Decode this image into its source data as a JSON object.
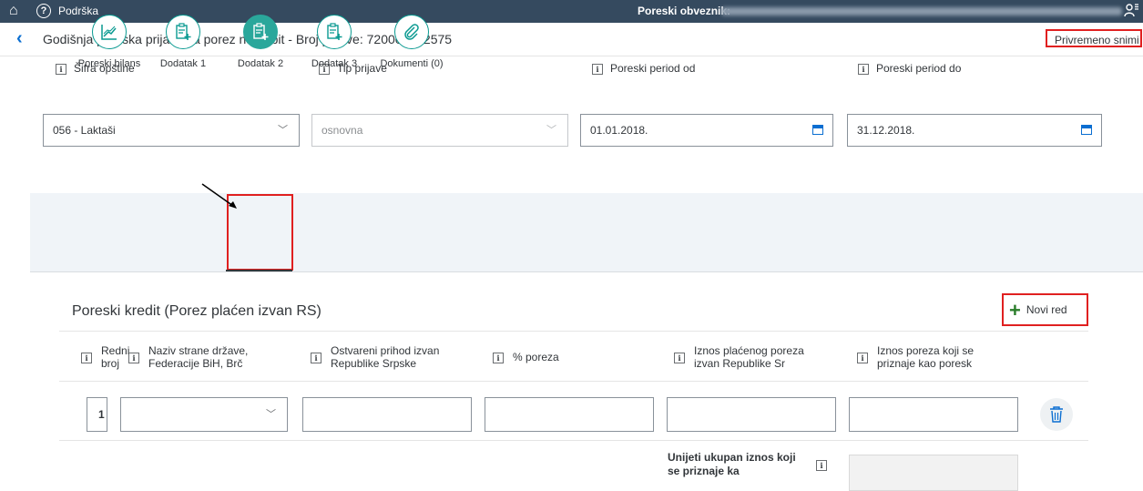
{
  "topbar": {
    "help_label": "Podrška",
    "taxpayer_label": "Poreski obveznik:"
  },
  "header": {
    "title": "Godišnja poreska prijava za porez na dobit - Broj prijave: 720000002575",
    "save_label": "Privremeno snimi"
  },
  "fields": {
    "opstina": {
      "label": "Šifra opštine",
      "value": "056 - Laktaši"
    },
    "tip": {
      "label": "Tip prijave",
      "value": "osnovna"
    },
    "period_od": {
      "label": "Poreski period od",
      "value": "01.01.2018."
    },
    "period_do": {
      "label": "Poreski period do",
      "value": "31.12.2018."
    }
  },
  "tabs": [
    {
      "label": "Poreski bilans",
      "icon": "chart-icon"
    },
    {
      "label": "Dodatak 1",
      "icon": "clipboard-add-icon"
    },
    {
      "label": "Dodatak 2",
      "icon": "clipboard-add-icon",
      "selected": true
    },
    {
      "label": "Dodatak 3",
      "icon": "clipboard-add-icon"
    },
    {
      "label": "Dokumenti (0)",
      "icon": "paperclip-icon"
    }
  ],
  "section": {
    "title": "Poreski kredit (Porez plaćen izvan RS)",
    "new_row_label": "Novi red"
  },
  "table": {
    "headers": [
      [
        "Redni",
        "broj"
      ],
      [
        "Naziv strane države,",
        "Federacije BiH, Brč"
      ],
      [
        "Ostvareni prihod izvan",
        "Republike Srpske"
      ],
      [
        "% poreza",
        ""
      ],
      [
        "Iznos plaćenog poreza",
        "izvan Republike Sr"
      ],
      [
        "Iznos poreza koji se",
        "priznaje kao poresk"
      ]
    ],
    "rows": [
      {
        "redni_broj": "1",
        "drzava": "",
        "prihod": "",
        "procenat": "",
        "placeni": "",
        "priznati": ""
      }
    ]
  },
  "total": {
    "label_line1": "Unijeti ukupan iznos koji",
    "label_line2": "se priznaje ka"
  },
  "colors": {
    "shell": "#354a5f",
    "accent": "#0a6ed1",
    "teal": "#2aa79b",
    "highlight_red": "#e02020"
  }
}
